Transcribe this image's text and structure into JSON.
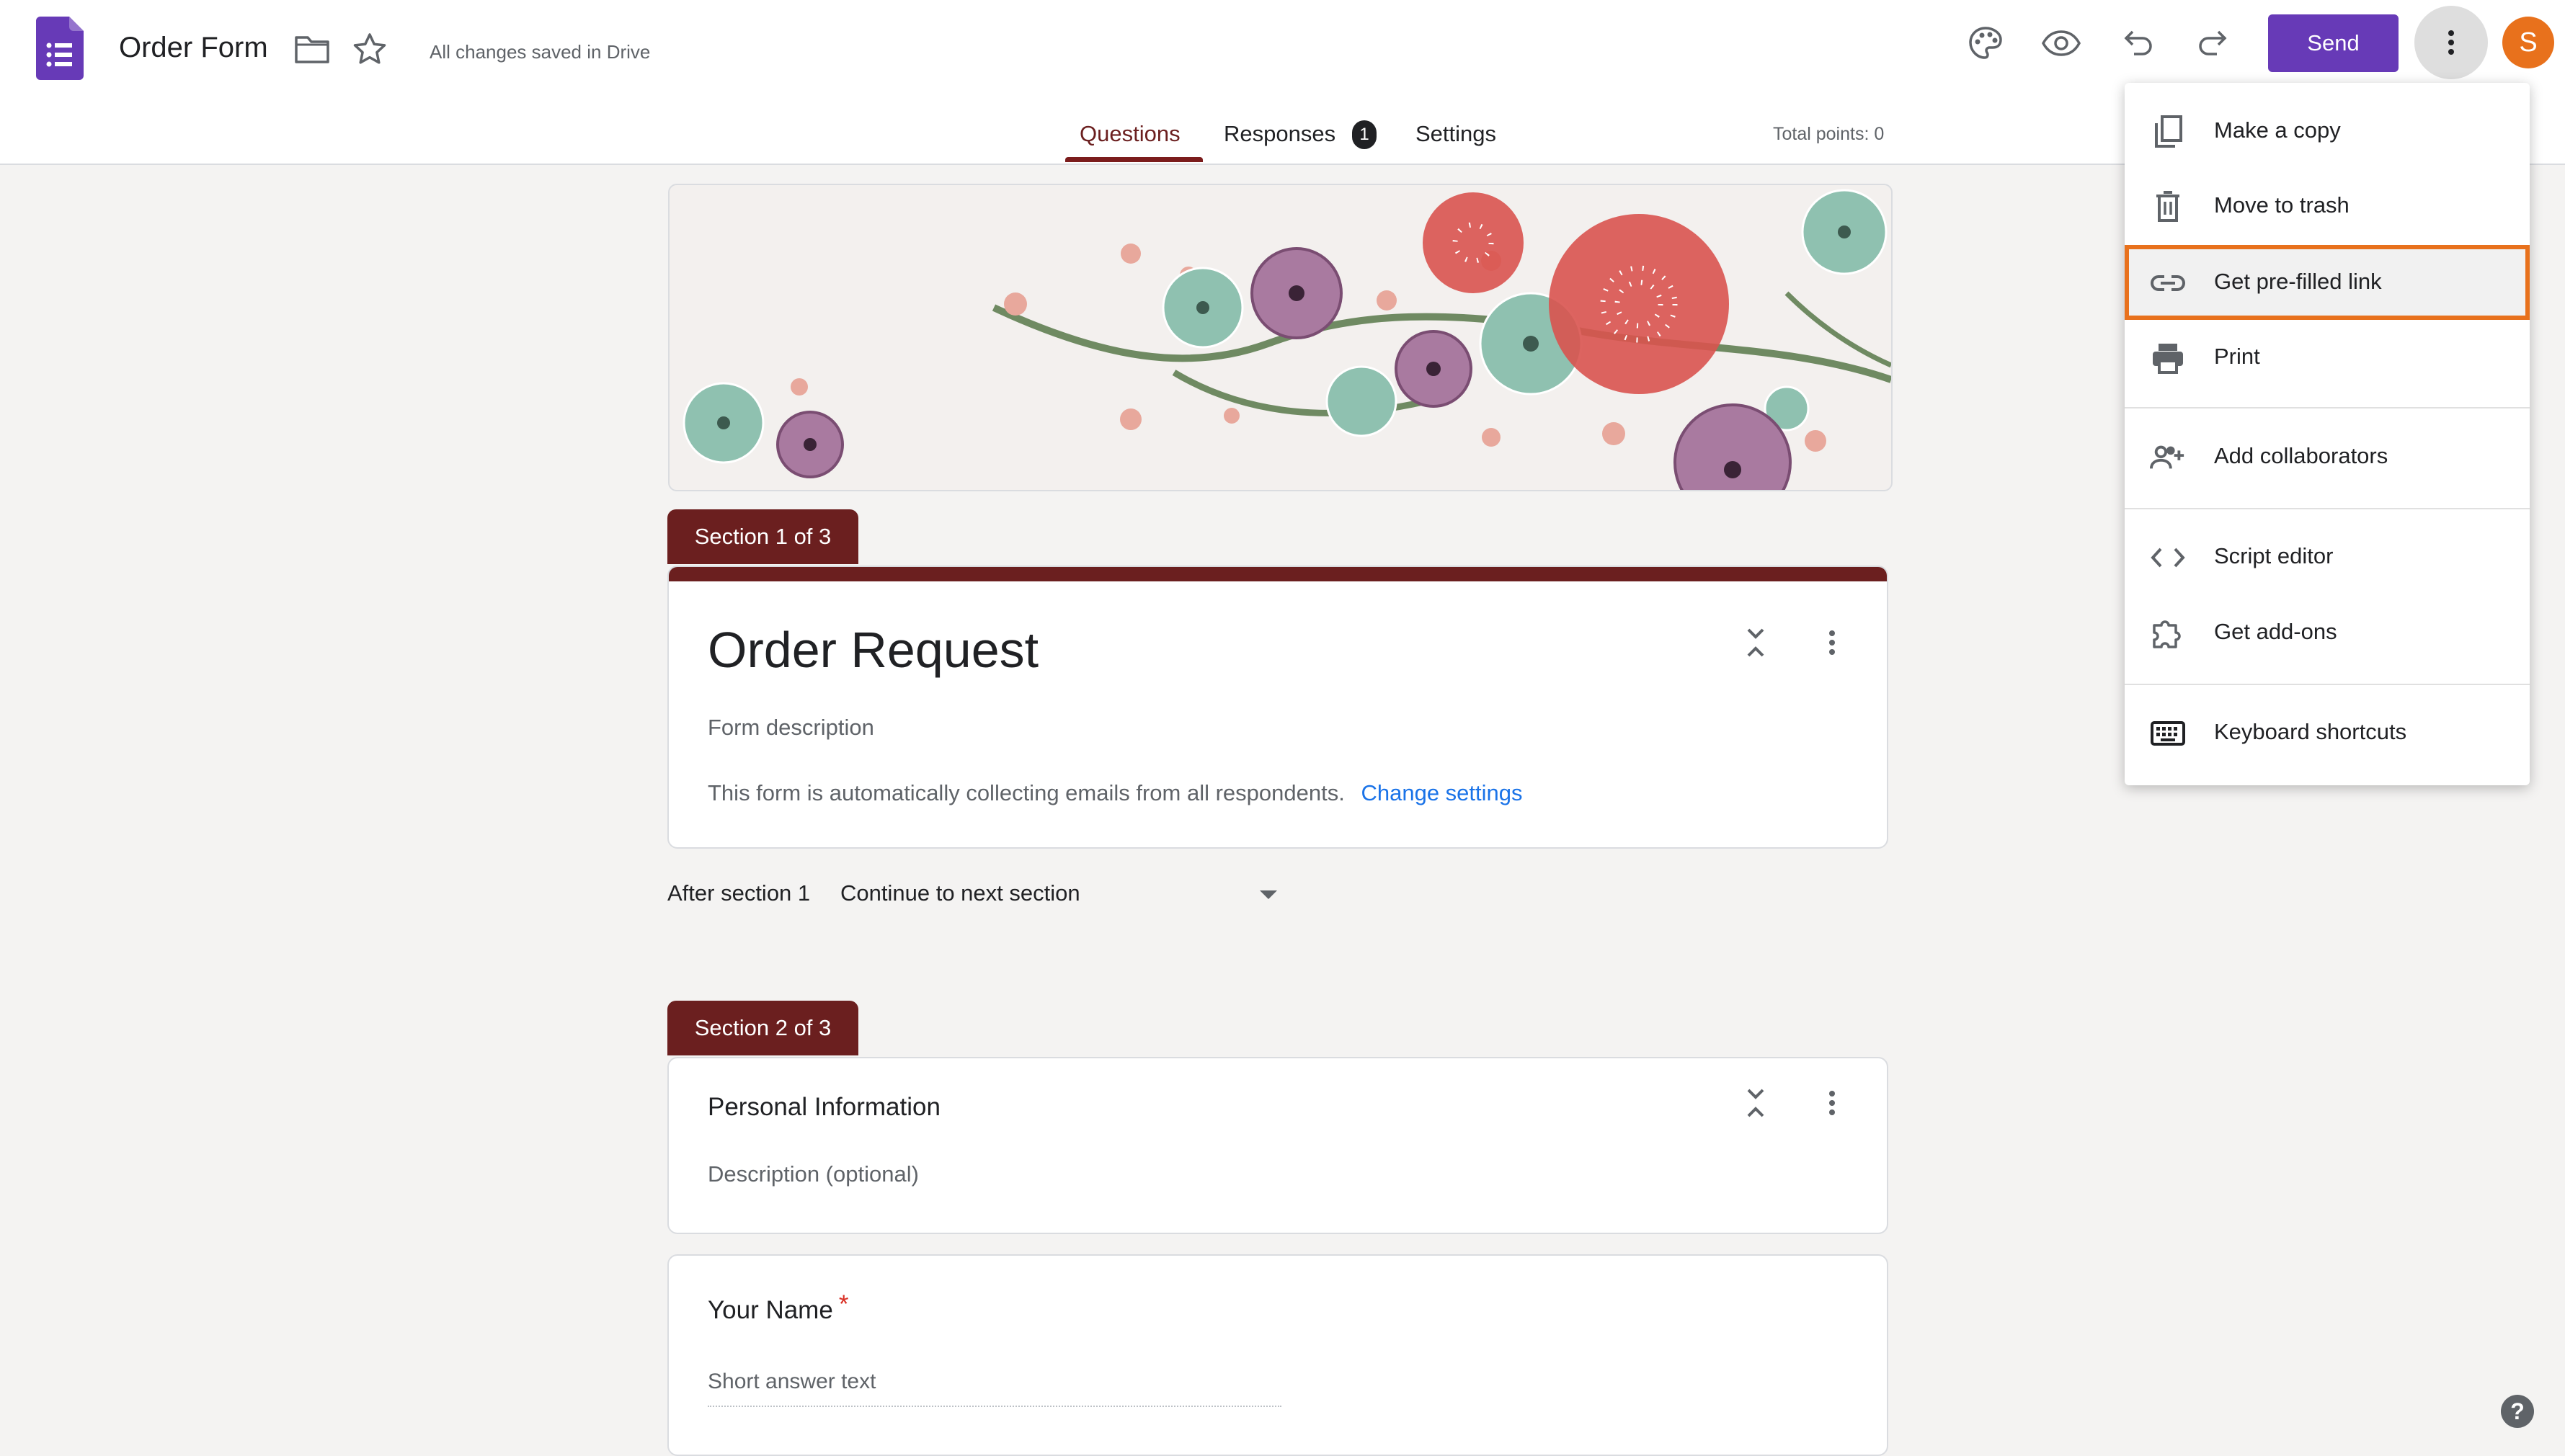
{
  "header": {
    "title": "Order Form",
    "save_status": "All changes saved in Drive",
    "send_label": "Send",
    "avatar_initial": "S",
    "icons": [
      "forms-logo-icon",
      "folder-icon",
      "star-icon",
      "palette-icon",
      "eye-icon",
      "undo-icon",
      "redo-icon",
      "more-vert-icon"
    ]
  },
  "tabs": [
    {
      "label": "Questions",
      "active": true
    },
    {
      "label": "Responses",
      "badge": "1"
    },
    {
      "label": "Settings"
    }
  ],
  "total_points": "Total points: 0",
  "sections": [
    {
      "tab_label": "Section 1 of 3",
      "title": "Order Request",
      "description": "Form description",
      "email_notice": "This form is automatically collecting emails from all respondents.",
      "email_link": "Change settings"
    },
    {
      "tab_label": "Section 2 of 3",
      "title": "Personal Information",
      "description": "Description (optional)"
    }
  ],
  "after_section": {
    "label": "After section 1",
    "value": "Continue to next section"
  },
  "question": {
    "title": "Your Name",
    "required_mark": "*",
    "placeholder": "Short answer text"
  },
  "menu": {
    "items": [
      {
        "label": "Make a copy",
        "icon": "copy-icon"
      },
      {
        "label": "Move to trash",
        "icon": "trash-icon"
      },
      {
        "label": "Get pre-filled link",
        "icon": "link-icon",
        "highlighted": true
      },
      {
        "label": "Print",
        "icon": "print-icon"
      },
      {
        "label": "Add collaborators",
        "icon": "add-people-icon"
      },
      {
        "label": "Script editor",
        "icon": "code-icon"
      },
      {
        "label": "Get add-ons",
        "icon": "puzzle-icon"
      },
      {
        "label": "Keyboard shortcuts",
        "icon": "keyboard-icon"
      }
    ]
  },
  "help_label": "?",
  "colors": {
    "accent": "#673ab7",
    "theme": "#6b1f1f",
    "highlight_outline": "#e8711c",
    "background": "#f4f3f2"
  }
}
